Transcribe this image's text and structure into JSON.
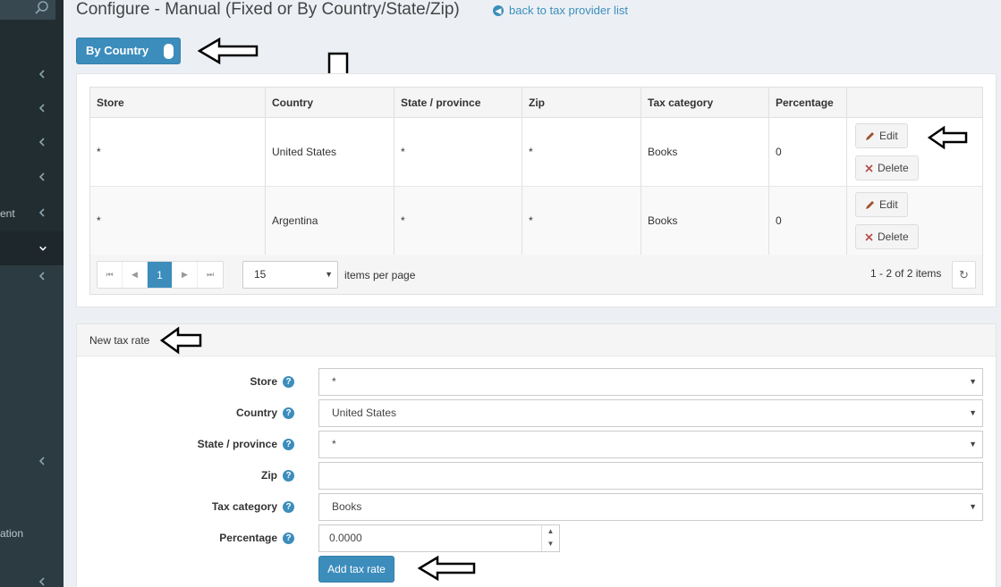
{
  "sidebar": {
    "items": [
      {
        "label": ""
      },
      {
        "label": ""
      },
      {
        "label": ""
      },
      {
        "label": ""
      },
      {
        "label": "ent"
      },
      {
        "label": ""
      },
      {
        "label": ""
      }
    ],
    "bottom_label": "ation"
  },
  "header": {
    "title": "Configure - Manual (Fixed or By Country/State/Zip)",
    "back_link": "back to tax provider list"
  },
  "toggle": {
    "label": "By Country"
  },
  "grid": {
    "columns": [
      "Store",
      "Country",
      "State / province",
      "Zip",
      "Tax category",
      "Percentage",
      ""
    ],
    "rows": [
      {
        "store": "*",
        "country": "United States",
        "state": "*",
        "zip": "*",
        "category": "Books",
        "percentage": "0"
      },
      {
        "store": "*",
        "country": "Argentina",
        "state": "*",
        "zip": "*",
        "category": "Books",
        "percentage": "0"
      }
    ],
    "edit_label": "Edit",
    "delete_label": "Delete"
  },
  "pager": {
    "current_page": "1",
    "page_size": "15",
    "items_per_page_label": "items per page",
    "info": "1 - 2 of 2 items"
  },
  "new_tax_rate": {
    "title": "New tax rate",
    "fields": {
      "store": {
        "label": "Store",
        "value": "*"
      },
      "country": {
        "label": "Country",
        "value": "United States"
      },
      "state": {
        "label": "State / province",
        "value": "*"
      },
      "zip": {
        "label": "Zip",
        "value": ""
      },
      "category": {
        "label": "Tax category",
        "value": "Books"
      },
      "percentage": {
        "label": "Percentage",
        "value": "0.0000"
      }
    },
    "add_label": "Add tax rate"
  },
  "colors": {
    "primary": "#3c8dbc",
    "sidebar": "#222d32"
  }
}
